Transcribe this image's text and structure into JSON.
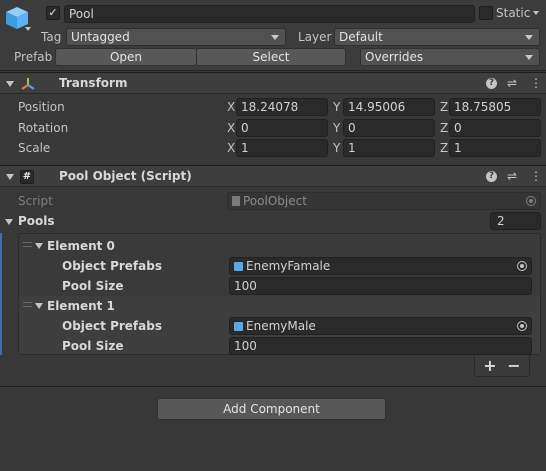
{
  "gameobject": {
    "name": "Pool",
    "static_label": "Static",
    "tag_label": "Tag",
    "tag_value": "Untagged",
    "layer_label": "Layer",
    "layer_value": "Default",
    "prefab_label": "Prefab",
    "open_label": "Open",
    "select_label": "Select",
    "overrides_label": "Overrides"
  },
  "transform": {
    "title": "Transform",
    "position_label": "Position",
    "rotation_label": "Rotation",
    "scale_label": "Scale",
    "x_axis": "X",
    "y_axis": "Y",
    "z_axis": "Z",
    "position": {
      "x": "18.24078",
      "y": "14.95006",
      "z": "18.75805"
    },
    "rotation": {
      "x": "0",
      "y": "0",
      "z": "0"
    },
    "scale": {
      "x": "1",
      "y": "1",
      "z": "1"
    }
  },
  "pool_object": {
    "title": "Pool Object (Script)",
    "script_label": "Script",
    "script_value": "PoolObject",
    "pools_label": "Pools",
    "pools_count": "2",
    "elements": [
      {
        "label": "Element 0",
        "prefab_label": "Object Prefabs",
        "prefab_value": "EnemyFamale",
        "size_label": "Pool Size",
        "size_value": "100"
      },
      {
        "label": "Element 1",
        "prefab_label": "Object Prefabs",
        "prefab_value": "EnemyMale",
        "size_label": "Pool Size",
        "size_value": "100"
      }
    ],
    "add_symbol": "+",
    "remove_symbol": "−"
  },
  "add_component_label": "Add Component",
  "icons": {
    "help": "?",
    "settings": "⇌",
    "more": "⋮",
    "script": "#"
  }
}
